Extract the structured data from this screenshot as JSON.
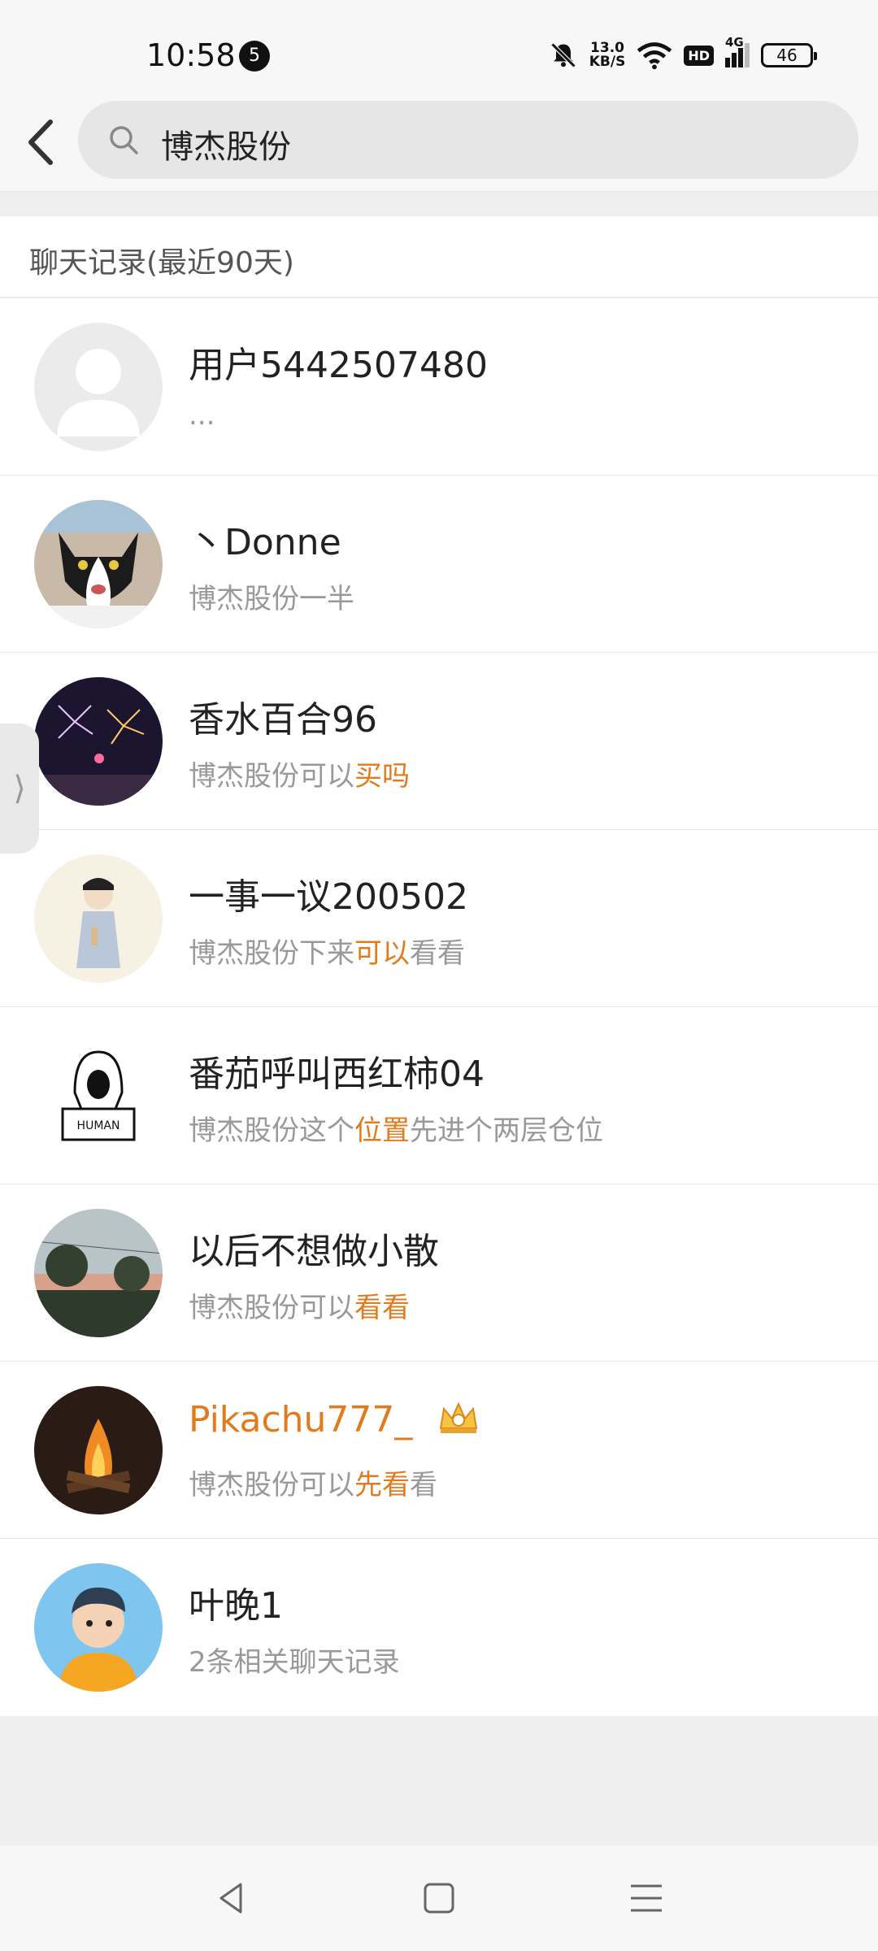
{
  "status_bar": {
    "time": "10:58",
    "notification_count": "5",
    "net_speed_value": "13.0",
    "net_speed_unit": "KB/S",
    "hd_label": "HD",
    "signal_label": "4G",
    "battery": "46"
  },
  "search": {
    "query": "博杰股份",
    "icon": "search-icon"
  },
  "section": {
    "title": "聊天记录(最近90天)"
  },
  "conversations": [
    {
      "name": "用户5442507480",
      "snippet_parts": [
        "..."
      ],
      "vip": false,
      "avatar": "default-avatar"
    },
    {
      "name": "丶Donne",
      "snippet_parts": [
        "博杰股份一半"
      ],
      "vip": false,
      "avatar": "cat-avatar"
    },
    {
      "name": "香水百合96",
      "snippet_parts": [
        "博杰股份可以",
        "买吗"
      ],
      "vip": false,
      "avatar": "fireworks-avatar"
    },
    {
      "name": "一事一议200502",
      "snippet_parts": [
        "博杰股份下来",
        "可以",
        "看看"
      ],
      "vip": false,
      "avatar": "cartoon-avatar"
    },
    {
      "name": "番茄呼叫西红柿04",
      "snippet_parts": [
        "博杰股份这个",
        "位置",
        "先进个两层仓位"
      ],
      "vip": false,
      "avatar": "human-sketch-avatar"
    },
    {
      "name": "以后不想做小散",
      "snippet_parts": [
        "博杰股份可以",
        "看看"
      ],
      "vip": false,
      "avatar": "landscape-avatar"
    },
    {
      "name": "Pikachu777_",
      "snippet_parts": [
        "博杰股份可以",
        "先看",
        "看"
      ],
      "vip": true,
      "avatar": "bonfire-avatar"
    },
    {
      "name": "叶晚1",
      "snippet_parts": [
        "2条相关聊天记录"
      ],
      "vip": false,
      "avatar": "boy-avatar"
    }
  ],
  "side_tab": {
    "label": "⟩"
  },
  "colors": {
    "highlight": "#e07c1e",
    "background": "#efefef"
  }
}
